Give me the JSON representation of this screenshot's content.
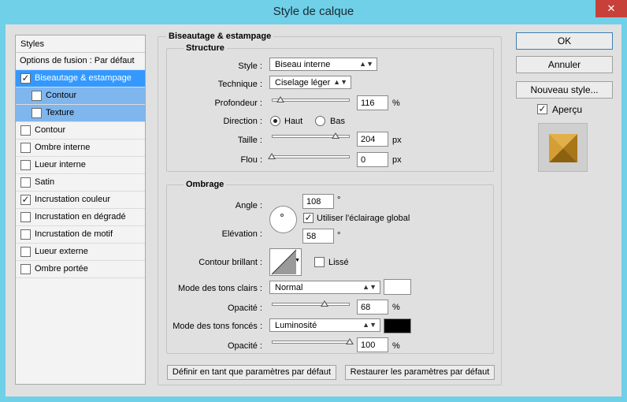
{
  "window": {
    "title": "Style de calque",
    "close_symbol": "✕"
  },
  "styles_panel": {
    "header": "Styles",
    "items": [
      {
        "label": "Options de fusion : Par défaut",
        "checked": false,
        "kind": "plain"
      },
      {
        "label": "Biseautage & estampage",
        "checked": true,
        "kind": "selected"
      },
      {
        "label": "Contour",
        "checked": false,
        "kind": "sub"
      },
      {
        "label": "Texture",
        "checked": false,
        "kind": "sub"
      },
      {
        "label": "Contour",
        "checked": false,
        "kind": "normal"
      },
      {
        "label": "Ombre interne",
        "checked": false,
        "kind": "normal"
      },
      {
        "label": "Lueur interne",
        "checked": false,
        "kind": "normal"
      },
      {
        "label": "Satin",
        "checked": false,
        "kind": "normal"
      },
      {
        "label": "Incrustation couleur",
        "checked": true,
        "kind": "normal"
      },
      {
        "label": "Incrustation en dégradé",
        "checked": false,
        "kind": "normal"
      },
      {
        "label": "Incrustation de motif",
        "checked": false,
        "kind": "normal"
      },
      {
        "label": "Lueur externe",
        "checked": false,
        "kind": "normal"
      },
      {
        "label": "Ombre portée",
        "checked": false,
        "kind": "normal"
      }
    ]
  },
  "bevel": {
    "title": "Biseautage & estampage",
    "structure": {
      "title": "Structure",
      "style_label": "Style :",
      "style_value": "Biseau interne",
      "technique_label": "Technique :",
      "technique_value": "Ciselage léger",
      "depth_label": "Profondeur :",
      "depth_value": "116",
      "depth_unit": "%",
      "depth_slider_fraction": 0.116,
      "direction_label": "Direction :",
      "direction_up": "Haut",
      "direction_down": "Bas",
      "direction_selected": "Haut",
      "size_label": "Taille :",
      "size_value": "204",
      "size_unit": "px",
      "size_slider_fraction": 0.816,
      "soften_label": "Flou :",
      "soften_value": "0",
      "soften_unit": "px",
      "soften_slider_fraction": 0.0
    },
    "shading": {
      "title": "Ombrage",
      "angle_label": "Angle :",
      "angle_value": "108",
      "angle_unit": "°",
      "global_light_label": "Utiliser l'éclairage global",
      "global_light_checked": true,
      "altitude_label": "Elévation :",
      "altitude_value": "58",
      "altitude_unit": "°",
      "gloss_label": "Contour brillant :",
      "antialias_label": "Lissé",
      "antialias_checked": false,
      "highlight_mode_label": "Mode des tons clairs :",
      "highlight_mode_value": "Normal",
      "highlight_color": "#ffffff",
      "highlight_opacity_label": "Opacité :",
      "highlight_opacity_value": "68",
      "highlight_opacity_unit": "%",
      "highlight_opacity_fraction": 0.68,
      "shadow_mode_label": "Mode des tons foncés :",
      "shadow_mode_value": "Luminosité",
      "shadow_color": "#000000",
      "shadow_opacity_label": "Opacité :",
      "shadow_opacity_value": "100",
      "shadow_opacity_unit": "%",
      "shadow_opacity_fraction": 1.0
    },
    "make_default_button": "Définir en tant que paramètres par défaut",
    "reset_default_button": "Restaurer les paramètres par défaut"
  },
  "buttons": {
    "ok": "OK",
    "cancel": "Annuler",
    "new_style": "Nouveau style...",
    "preview_label": "Aperçu",
    "preview_checked": true
  },
  "colors": {
    "accent": "#3399ff",
    "title_bar": "#6fd0e8",
    "preview_gold": "#c8962a"
  }
}
